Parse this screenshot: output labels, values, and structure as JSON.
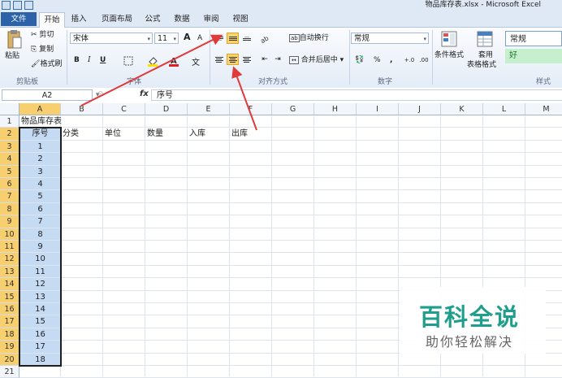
{
  "window": {
    "title": "物品库存表.xlsx - Microsoft Excel"
  },
  "tabs": [
    "文件",
    "开始",
    "插入",
    "页面布局",
    "公式",
    "数据",
    "审阅",
    "视图"
  ],
  "clipboard": {
    "paste": "粘贴",
    "cut": "剪切",
    "copy": "复制",
    "format_painter": "格式刷",
    "group": "剪贴板"
  },
  "font": {
    "name": "宋体",
    "size": "11",
    "bold": "B",
    "italic": "I",
    "underline": "U",
    "grow": "A",
    "shrink": "A",
    "group": "字体"
  },
  "alignment": {
    "wrap_text": "自动换行",
    "merge_center": "合并后居中",
    "group": "对齐方式"
  },
  "number": {
    "format": "常规",
    "percent": "%",
    "comma": ",",
    "group": "数字"
  },
  "styles": {
    "conditional": "条件格式",
    "table_fmt_1": "套用",
    "table_fmt_2": "表格格式",
    "normal": "常规",
    "good": "好",
    "group": "样式"
  },
  "formula_bar": {
    "name_box": "A2",
    "fx": "fx",
    "content": "序号"
  },
  "grid": {
    "columns": [
      "A",
      "B",
      "C",
      "D",
      "E",
      "F",
      "G",
      "H",
      "I",
      "J",
      "K",
      "L",
      "M"
    ],
    "rows": [
      "1",
      "2",
      "3",
      "4",
      "5",
      "6",
      "7",
      "8",
      "9",
      "10",
      "11",
      "12",
      "13",
      "14",
      "15",
      "16",
      "17",
      "18",
      "19",
      "20",
      "21"
    ],
    "title": "物品库存表",
    "headers": [
      "序号",
      "分类",
      "单位",
      "数量",
      "入库",
      "出库"
    ],
    "serials": [
      "1",
      "2",
      "3",
      "4",
      "5",
      "6",
      "7",
      "8",
      "9",
      "10",
      "11",
      "12",
      "13",
      "14",
      "15",
      "16",
      "17",
      "18"
    ]
  },
  "watermark": {
    "big": "百科全说",
    "small": "助你轻松解决"
  },
  "colors": {
    "accent": "#2b62a8",
    "selection": "#c5daf3",
    "header_selected": "#f8cf6f",
    "arrow": "#e03a3a",
    "watermark": "#1f9e8c"
  }
}
